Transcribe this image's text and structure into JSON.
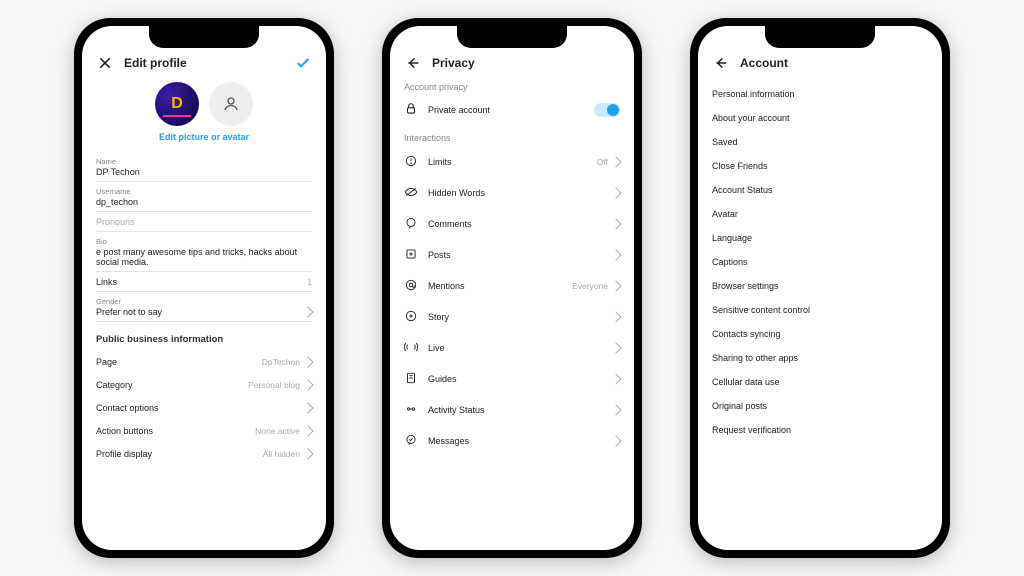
{
  "phone1": {
    "header": {
      "title": "Edit profile"
    },
    "editLink": "Edit picture or avatar",
    "fields": {
      "name": {
        "label": "Name",
        "value": "DP Techon"
      },
      "username": {
        "label": "Username",
        "value": "dp_techon"
      },
      "pronouns": {
        "label": "Pronouns",
        "value": ""
      },
      "bio": {
        "label": "Bio",
        "value": "e post many awesome tips and tricks, hacks about social media."
      },
      "links": {
        "label": "Links",
        "value": "1"
      },
      "gender": {
        "label": "Gender",
        "value": "Prefer not to say"
      }
    },
    "businessSection": "Public business information",
    "businessRows": [
      {
        "label": "Page",
        "meta": "DpTechon"
      },
      {
        "label": "Category",
        "meta": "Personal blog"
      },
      {
        "label": "Contact options",
        "meta": ""
      },
      {
        "label": "Action buttons",
        "meta": "None active"
      },
      {
        "label": "Profile display",
        "meta": "All hidden"
      }
    ]
  },
  "phone2": {
    "header": {
      "title": "Privacy"
    },
    "section1": "Account privacy",
    "privateAccount": "Private account",
    "section2": "Interactions",
    "interactions": [
      {
        "icon": "limits",
        "label": "Limits",
        "meta": "Off"
      },
      {
        "icon": "hidden-words",
        "label": "Hidden Words",
        "meta": ""
      },
      {
        "icon": "comments",
        "label": "Comments",
        "meta": ""
      },
      {
        "icon": "posts",
        "label": "Posts",
        "meta": ""
      },
      {
        "icon": "mentions",
        "label": "Mentions",
        "meta": "Everyone"
      },
      {
        "icon": "story",
        "label": "Story",
        "meta": ""
      },
      {
        "icon": "live",
        "label": "Live",
        "meta": ""
      },
      {
        "icon": "guides",
        "label": "Guides",
        "meta": ""
      },
      {
        "icon": "activity-status",
        "label": "Activity Status",
        "meta": ""
      },
      {
        "icon": "messages",
        "label": "Messages",
        "meta": ""
      }
    ]
  },
  "phone3": {
    "header": {
      "title": "Account"
    },
    "items": [
      "Personal information",
      "About your account",
      "Saved",
      "Close Friends",
      "Account Status",
      "Avatar",
      "Language",
      "Captions",
      "Browser settings",
      "Sensitive content control",
      "Contacts syncing",
      "Sharing to other apps",
      "Cellular data use",
      "Original posts",
      "Request verification"
    ]
  }
}
